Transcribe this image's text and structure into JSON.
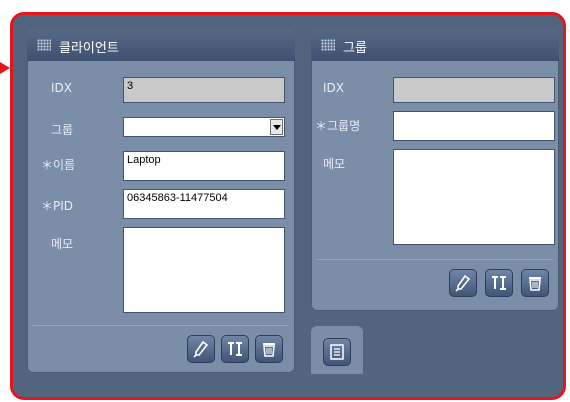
{
  "client_panel": {
    "title": "클라이언트",
    "idx_label": "IDX",
    "idx_value": "3",
    "group_label": "그룹",
    "group_value": "",
    "name_label": "＊이름",
    "name_value": "Laptop",
    "pid_label": "＊PID",
    "pid_value": "06345863-11477504",
    "memo_label": "메모",
    "memo_value": "",
    "buttons": [
      "edit-icon",
      "tools-icon",
      "trash-icon"
    ]
  },
  "group_panel": {
    "title": "그룹",
    "idx_label": "IDX",
    "idx_value": "",
    "group_name_label": "＊그룹명",
    "group_name_value": "",
    "memo_label": "메모",
    "memo_value": "",
    "buttons": [
      "edit-icon",
      "tools-icon",
      "trash-icon"
    ]
  },
  "bottom_tab": {
    "icon": "list-icon"
  },
  "colors": {
    "highlight": "#e8141b",
    "panel": "#7a8ea8",
    "background": "#52657f"
  }
}
